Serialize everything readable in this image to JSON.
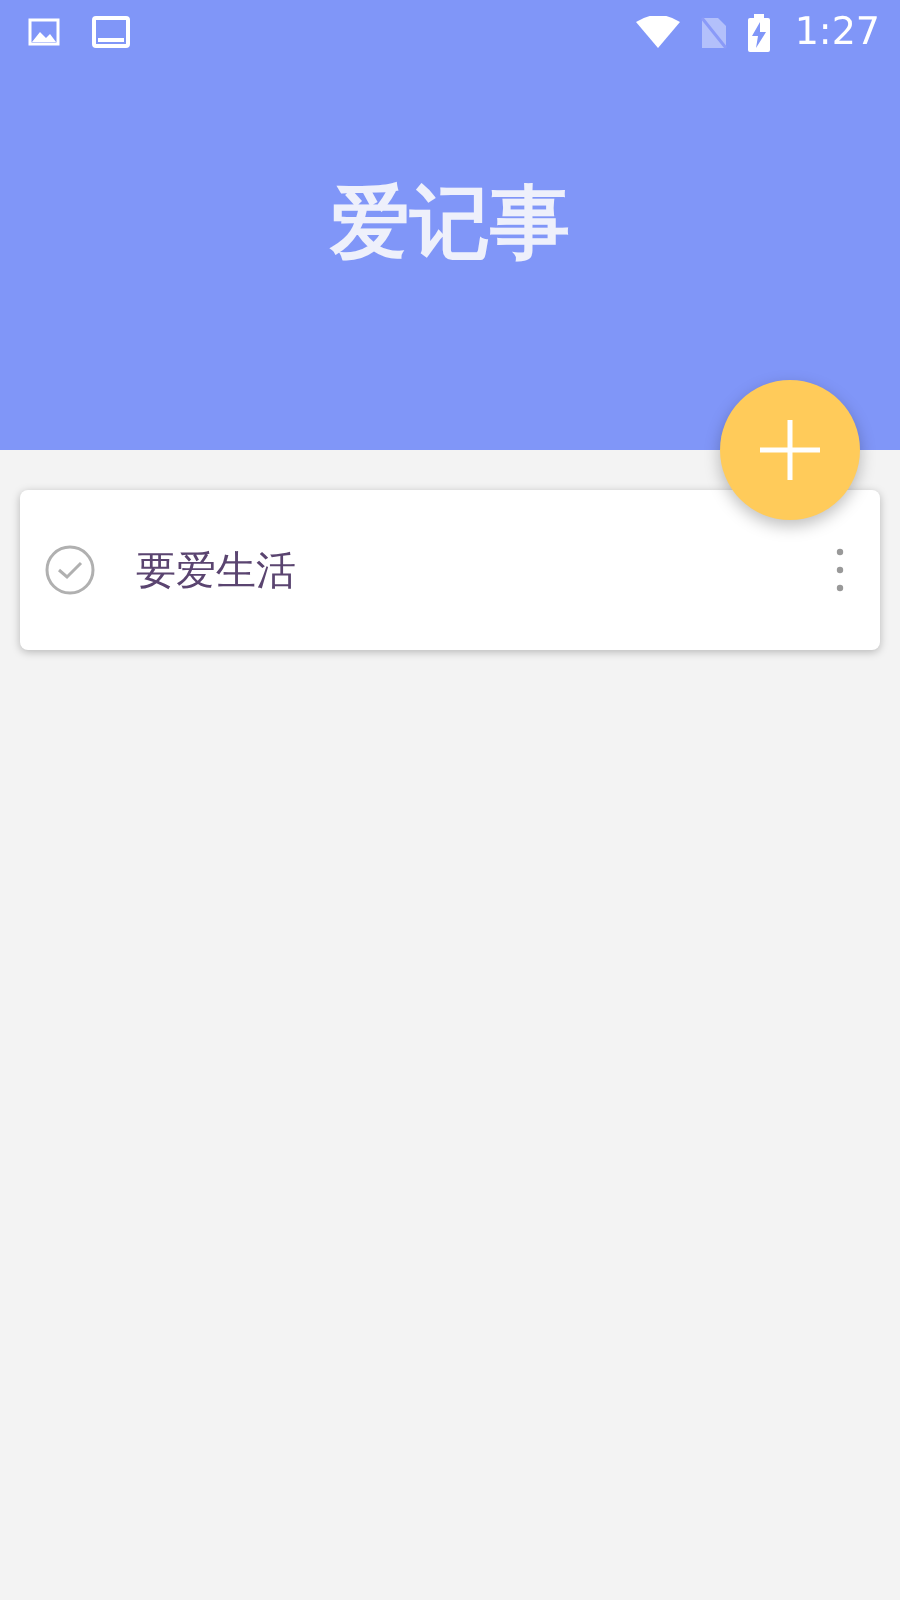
{
  "status_bar": {
    "time": "1:27"
  },
  "header": {
    "title": "爱记事"
  },
  "notes": [
    {
      "text": "要爱生活",
      "done": false
    }
  ]
}
